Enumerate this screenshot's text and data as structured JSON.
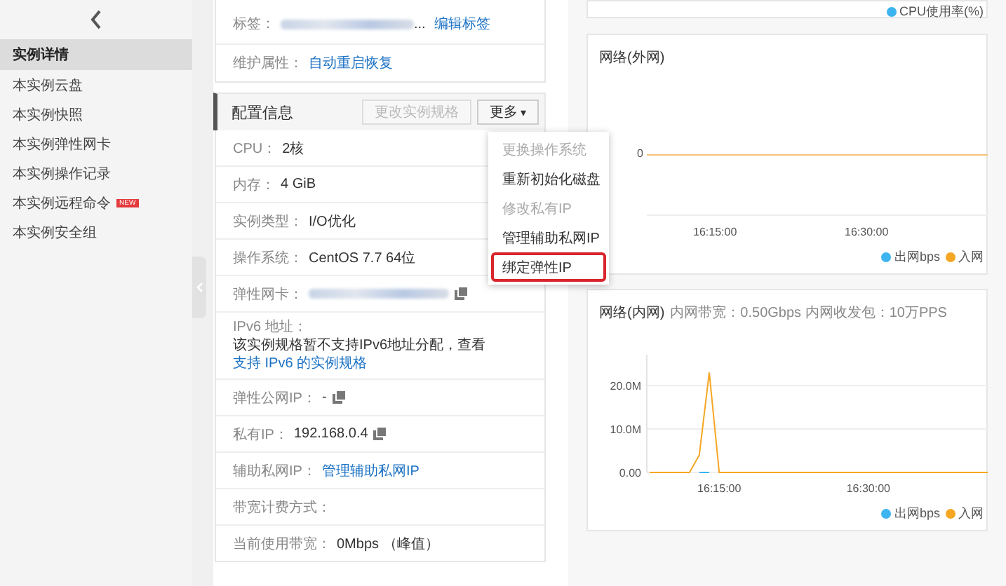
{
  "sidebar": {
    "items": [
      {
        "label": "实例详情",
        "selected": true
      },
      {
        "label": "本实例云盘",
        "selected": false
      },
      {
        "label": "本实例快照",
        "selected": false
      },
      {
        "label": "本实例弹性网卡",
        "selected": false
      },
      {
        "label": "本实例操作记录",
        "selected": false
      },
      {
        "label": "本实例远程命令",
        "selected": false,
        "badge": "NEW"
      },
      {
        "label": "本实例安全组",
        "selected": false
      }
    ]
  },
  "basic_info": {
    "rows": [
      {
        "kind": "tag",
        "label": "标签：",
        "suffix": "...",
        "link": "编辑标签"
      },
      {
        "kind": "link",
        "label": "维护属性：",
        "link": "自动重启恢复"
      }
    ]
  },
  "config": {
    "title": "配置信息",
    "buttons": [
      {
        "label": "更改实例规格",
        "disabled": true
      },
      {
        "label": "更多",
        "disabled": false,
        "caret": "▾"
      }
    ],
    "rows": [
      {
        "kind": "text",
        "label": "CPU：",
        "value": "2核",
        "copy": false
      },
      {
        "kind": "text",
        "label": "内存：",
        "value": "4 GiB",
        "copy": false
      },
      {
        "kind": "text",
        "label": "实例类型：",
        "value": "I/O优化",
        "copy": false
      },
      {
        "kind": "text",
        "label": "操作系统：",
        "value": "CentOS 7.7 64位",
        "copy": false
      },
      {
        "kind": "blurred",
        "label": "弹性网卡：",
        "copy": true
      },
      {
        "kind": "note",
        "label": "IPv6 地址：",
        "text": "该实例规格暂不支持IPv6地址分配，查看",
        "link": "支持 IPv6 的实例规格"
      },
      {
        "kind": "text",
        "label": "弹性公网IP：",
        "value": "-",
        "copy": true
      },
      {
        "kind": "text",
        "label": "私有IP：",
        "value": "192.168.0.4",
        "copy": true
      },
      {
        "kind": "link",
        "label": "辅助私网IP：",
        "link": "管理辅助私网IP"
      },
      {
        "kind": "text",
        "label": "带宽计费方式：",
        "copy": false
      },
      {
        "kind": "text",
        "label": "当前使用带宽：",
        "value": "0Mbps （峰值）",
        "copy": false
      }
    ]
  },
  "menu": {
    "items": [
      {
        "label": "更换操作系统",
        "disabled": true,
        "selected": false
      },
      {
        "label": "重新初始化磁盘",
        "disabled": false,
        "selected": false
      },
      {
        "label": "修改私有IP",
        "disabled": true,
        "selected": false
      },
      {
        "label": "管理辅助私网IP",
        "disabled": false,
        "selected": false
      },
      {
        "label": "绑定弹性IP",
        "disabled": false,
        "selected": true
      }
    ]
  },
  "cpu_chart": {
    "legend": [
      {
        "label": "CPU使用率(%)",
        "color": "#3cb4f0"
      }
    ]
  },
  "external_network_chart": {
    "title": "网络(外网)",
    "y_tick": "0",
    "x_ticks": [
      "16:15:00",
      "16:30:00"
    ],
    "legend": [
      {
        "label": "出网bps",
        "color": "#3cb4f0"
      },
      {
        "label": "入网",
        "color": "#f5a623"
      }
    ]
  },
  "internal_network_chart": {
    "title": "网络(内网)",
    "subtitle": "内网带宽：0.50Gbps 内网收发包：10万PPS",
    "chart_data": {
      "type": "line",
      "categories": [
        null,
        null,
        null,
        null,
        null,
        null,
        null,
        "16:15:00",
        null,
        null,
        null,
        null,
        null,
        null,
        null,
        null,
        null,
        null,
        null,
        null,
        null,
        null,
        "16:30:00",
        null,
        null,
        null,
        null,
        null,
        null,
        null,
        null,
        null,
        null,
        null,
        null
      ],
      "series": [
        {
          "name": "出网bps",
          "color": "#3cb4f0",
          "values": [
            null,
            null,
            null,
            null,
            null,
            0,
            0,
            null,
            null,
            null,
            null,
            null,
            null,
            null,
            null,
            null,
            null,
            null,
            null,
            null,
            null,
            null,
            null,
            null,
            null,
            null,
            null,
            null,
            null,
            null,
            null,
            null,
            null,
            null,
            null
          ]
        },
        {
          "name": "入网",
          "color": "#f5a623",
          "values": [
            0,
            0,
            0,
            0,
            0,
            4000000,
            23000000,
            0,
            0,
            0,
            0,
            0,
            0,
            0,
            0,
            0,
            0,
            0,
            0,
            0,
            0,
            0,
            0,
            0,
            0,
            0,
            0,
            0,
            0,
            0,
            0,
            0,
            0,
            0,
            0
          ]
        }
      ],
      "ylim": [
        0,
        27000000
      ],
      "yticks": [
        {
          "value": 0,
          "label": "0.00"
        },
        {
          "value": 10000000,
          "label": "10.0M"
        },
        {
          "value": 20000000,
          "label": "20.0M"
        }
      ]
    }
  }
}
